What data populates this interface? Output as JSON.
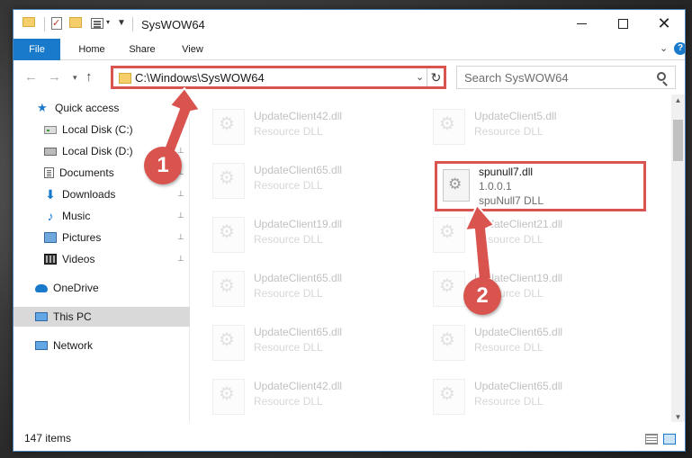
{
  "window": {
    "title": "SysWOW64"
  },
  "quick_access_toolbar": {
    "dropdown_glyph": "▾",
    "customize_glyph": "▼"
  },
  "ribbon": {
    "tabs": [
      "File",
      "Home",
      "Share",
      "View"
    ],
    "expand_glyph": "⌄",
    "help_glyph": "?"
  },
  "navigation": {
    "back_glyph": "←",
    "forward_glyph": "→",
    "recent_glyph": "▾",
    "up_glyph": "↑",
    "address": "C:\\Windows\\SysWOW64",
    "address_dropdown_glyph": "⌄",
    "refresh_glyph": "↻",
    "search_placeholder": "Search SysWOW64"
  },
  "sidebar": {
    "items": [
      {
        "label": "Quick access",
        "icon": "star-icon",
        "pinned": false
      },
      {
        "label": "Local Disk (C:)",
        "icon": "disk-icon",
        "pinned": true
      },
      {
        "label": "Local Disk (D:)",
        "icon": "disk-icon",
        "pinned": true
      },
      {
        "label": "Documents",
        "icon": "document-icon",
        "pinned": true
      },
      {
        "label": "Downloads",
        "icon": "download-icon",
        "pinned": true
      },
      {
        "label": "Music",
        "icon": "music-icon",
        "pinned": true
      },
      {
        "label": "Pictures",
        "icon": "picture-icon",
        "pinned": true
      },
      {
        "label": "Videos",
        "icon": "video-icon",
        "pinned": true
      },
      {
        "label": "OneDrive",
        "icon": "cloud-icon",
        "pinned": false
      },
      {
        "label": "This PC",
        "icon": "computer-icon",
        "pinned": false,
        "selected": true
      },
      {
        "label": "Network",
        "icon": "network-icon",
        "pinned": false
      }
    ],
    "pin_glyph": "📌"
  },
  "files": [
    {
      "name": "UpdateClient42.dll",
      "type": "Resource DLL",
      "faded": true
    },
    {
      "name": "UpdateClient5.dll",
      "type": "Resource DLL",
      "faded": true
    },
    {
      "name": "UpdateClient65.dll",
      "type": "Resource DLL",
      "faded": true
    },
    {
      "name": "spunull7.dll",
      "version": "1.0.0.1",
      "type": "spuNull7 DLL",
      "faded": false,
      "highlighted": true
    },
    {
      "name": "UpdateClient19.dll",
      "type": "Resource DLL",
      "faded": true
    },
    {
      "name": "UpdateClient21.dll",
      "type": "Resource DLL",
      "faded": true
    },
    {
      "name": "UpdateClient65.dll",
      "type": "Resource DLL",
      "faded": true
    },
    {
      "name": "UpdateClient19.dll",
      "type": "Resource DLL",
      "faded": true
    },
    {
      "name": "UpdateClient65.dll",
      "type": "Resource DLL",
      "faded": true
    },
    {
      "name": "UpdateClient65.dll",
      "type": "Resource DLL",
      "faded": true
    },
    {
      "name": "UpdateClient42.dll",
      "type": "Resource DLL",
      "faded": true
    },
    {
      "name": "UpdateClient65.dll",
      "type": "Resource DLL",
      "faded": true
    }
  ],
  "status": {
    "item_count": "147 items"
  },
  "annotations": {
    "step1": "1",
    "step2": "2",
    "accent_color": "#d9534f"
  },
  "colors": {
    "file_tab": "#1979ca",
    "annotation_red": "#d9534f",
    "selected_row": "#d9d9d9"
  }
}
